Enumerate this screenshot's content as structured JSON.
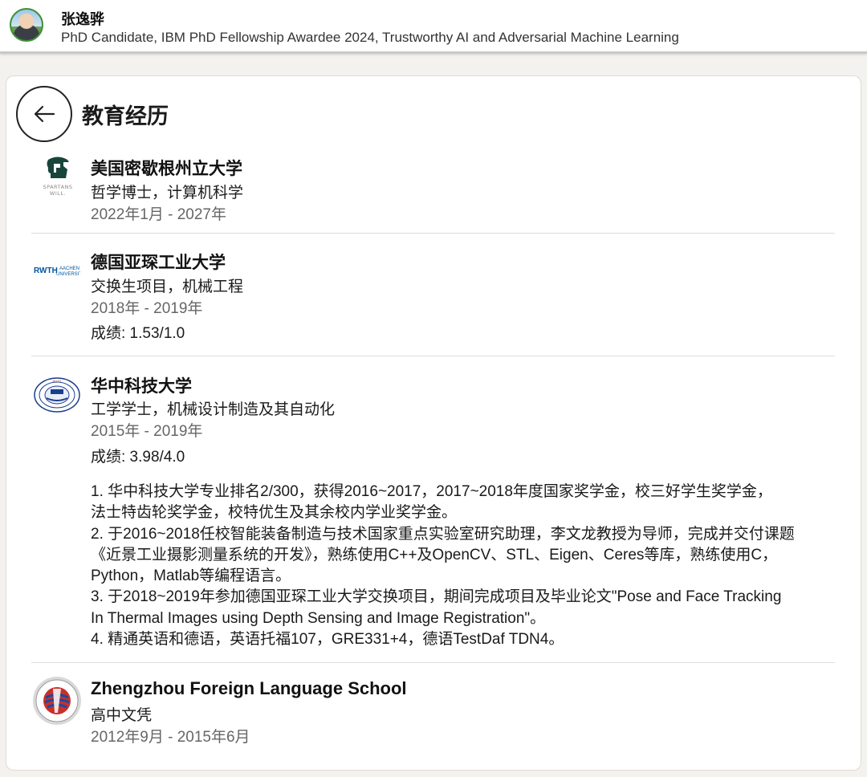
{
  "header": {
    "name": "张逸骅",
    "headline": "PhD Candidate, IBM PhD Fellowship Awardee 2024, Trustworthy AI and Adversarial Machine Learning"
  },
  "page": {
    "title": "教育经历"
  },
  "education": [
    {
      "school": "美国密歇根州立大学",
      "degree": "哲学博士，计算机科学",
      "dates": "2022年1月 - 2027年",
      "logo_text": "SPARTANS WILL."
    },
    {
      "school": "德国亚琛工业大学",
      "degree": "交换生项目，机械工程",
      "dates": "2018年 - 2019年",
      "grade": "成绩: 1.53/1.0",
      "logo_text": "RWTH AACHEN UNIVERSITY"
    },
    {
      "school": "华中科技大学",
      "degree": "工学学士，机械设计制造及其自动化",
      "dates": "2015年 - 2019年",
      "grade": "成绩: 3.98/4.0",
      "description_lines": [
        "1. 华中科技大学专业排名2/300，获得2016~2017，2017~2018年度国家奖学金，校三好学生奖学金，",
        "法士特齿轮奖学金，校特优生及其余校内学业奖学金。",
        "2. 于2016~2018任校智能装备制造与技术国家重点实验室研究助理，李文龙教授为导师，完成并交付课题",
        "《近景工业摄影测量系统的开发》，熟练使用C++及OpenCV、STL、Eigen、Ceres等库，熟练使用C，",
        "Python，Matlab等编程语言。",
        "3. 于2018~2019年参加德国亚琛工业大学交换项目，期间完成项目及毕业论文\"Pose and Face Tracking",
        "In Thermal Images using Depth Sensing and Image Registration\"。",
        "4. 精通英语和德语，英语托福107，GRE331+4，德语TestDaf TDN4。"
      ]
    },
    {
      "school": "Zhengzhou Foreign Language School",
      "degree": "高中文凭",
      "dates": "2012年9月 - 2015年6月"
    }
  ],
  "colors": {
    "page_bg": "#f4f2ee",
    "card_bg": "#ffffff",
    "msu_green": "#18453b",
    "rwth_blue": "#00549f",
    "hust_blue": "#1b3f8f",
    "zfls_red": "#c8302c"
  }
}
